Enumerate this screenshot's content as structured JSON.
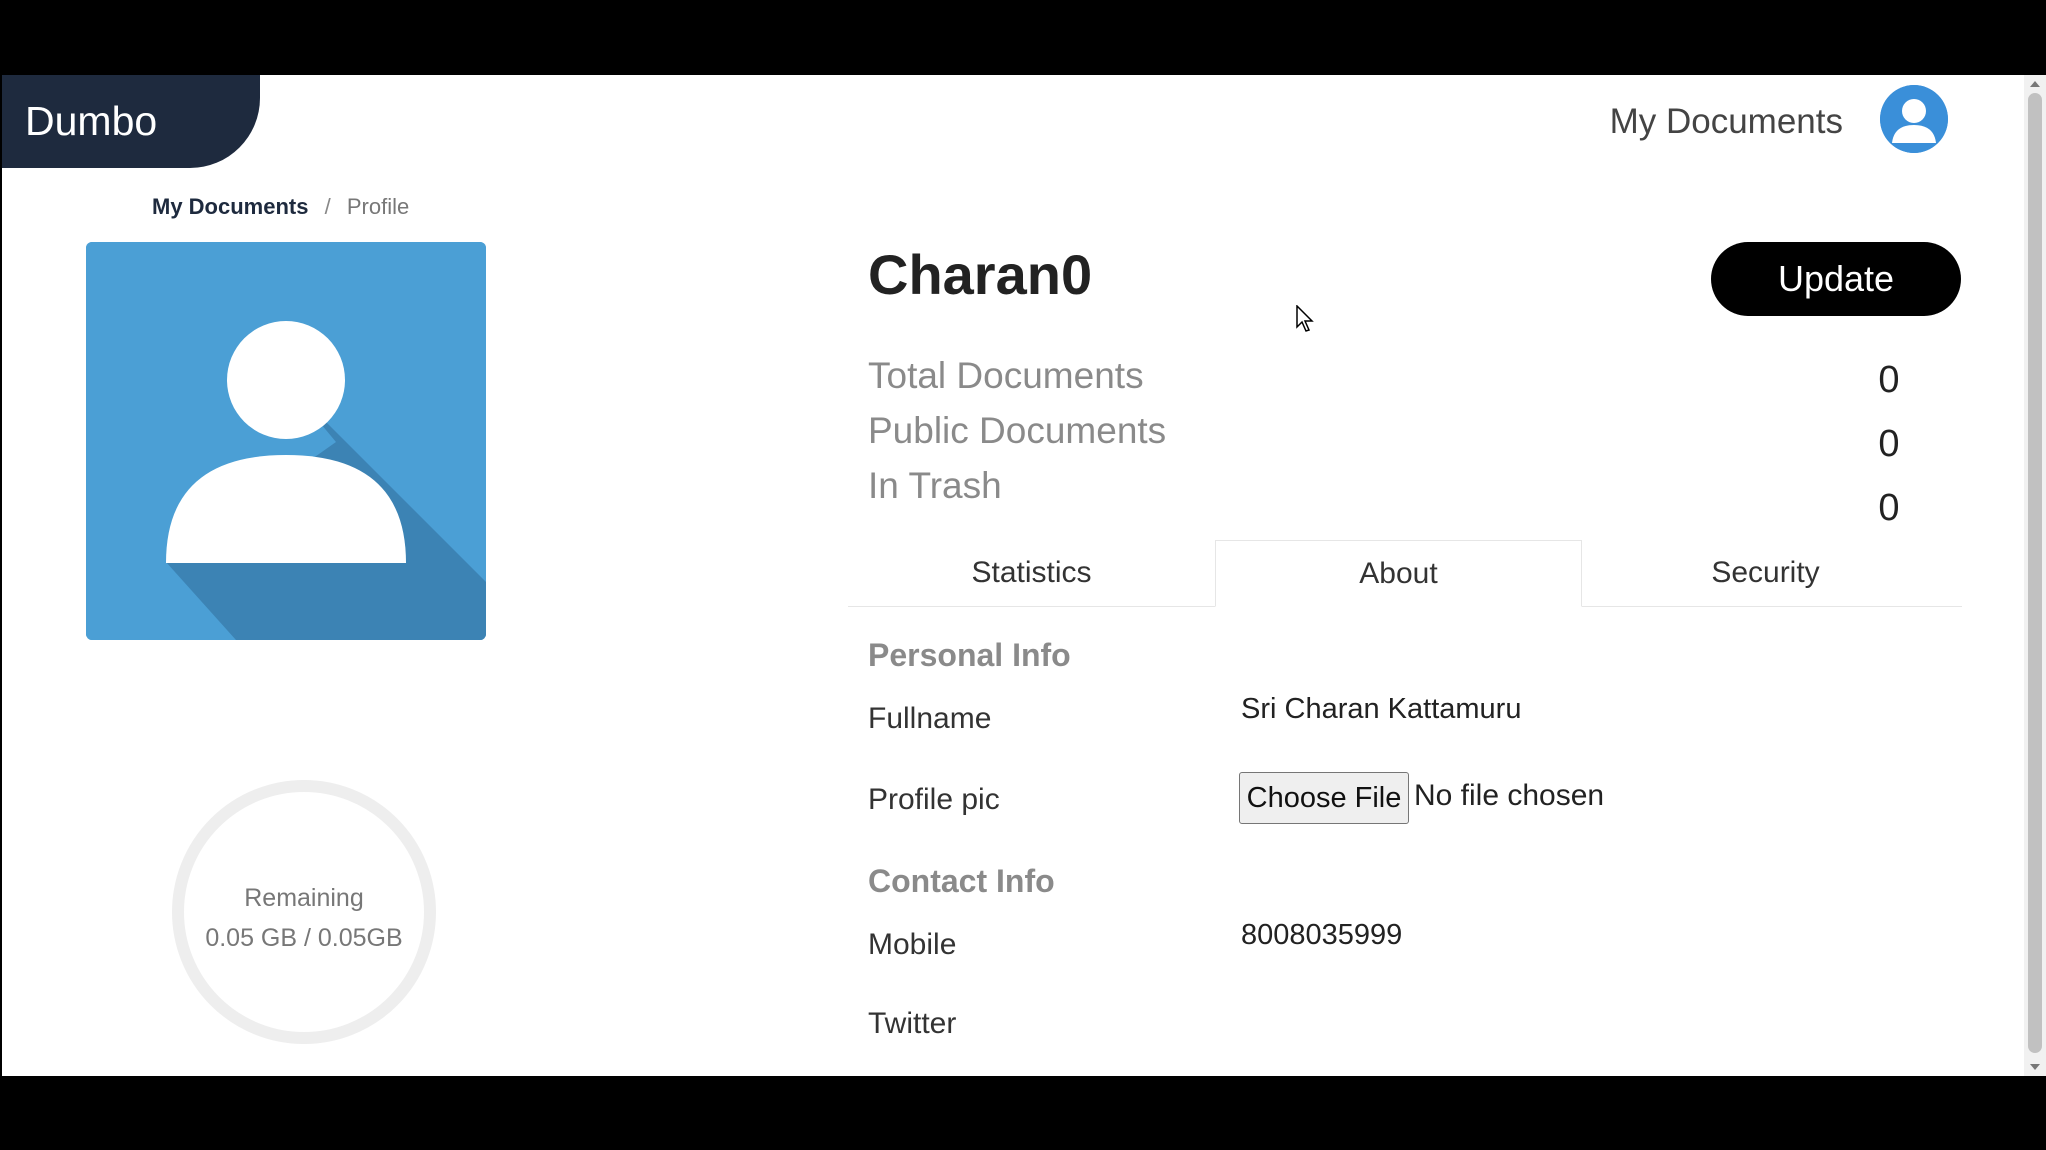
{
  "brand": {
    "name": "Dumbo"
  },
  "header": {
    "nav_link": "My Documents",
    "avatar_icon": "user-avatar-icon"
  },
  "breadcrumb": {
    "home": "My Documents",
    "separator": "/",
    "current": "Profile"
  },
  "storage": {
    "label": "Remaining",
    "usage": "0.05 GB / 0.05GB"
  },
  "profile": {
    "username": "Charan0",
    "update_label": "Update",
    "stats": [
      {
        "label": "Total Documents",
        "value": "0"
      },
      {
        "label": "Public Documents",
        "value": "0"
      },
      {
        "label": "In Trash",
        "value": "0"
      }
    ]
  },
  "tabs": [
    {
      "label": "Statistics",
      "active": false
    },
    {
      "label": "About",
      "active": true
    },
    {
      "label": "Security",
      "active": false
    }
  ],
  "about": {
    "personal_heading": "Personal Info",
    "fullname_label": "Fullname",
    "fullname_value": "Sri Charan Kattamuru",
    "profile_pic_label": "Profile pic",
    "file_button": "Choose File",
    "file_status": "No file chosen",
    "contact_heading": "Contact Info",
    "mobile_label": "Mobile",
    "mobile_value": "8008035999",
    "twitter_label": "Twitter"
  },
  "colors": {
    "brand_bg": "#1e2a3e",
    "avatar_blue": "#3a8fd9",
    "profile_blue": "#4b9fd5",
    "button_bg": "#000000"
  }
}
